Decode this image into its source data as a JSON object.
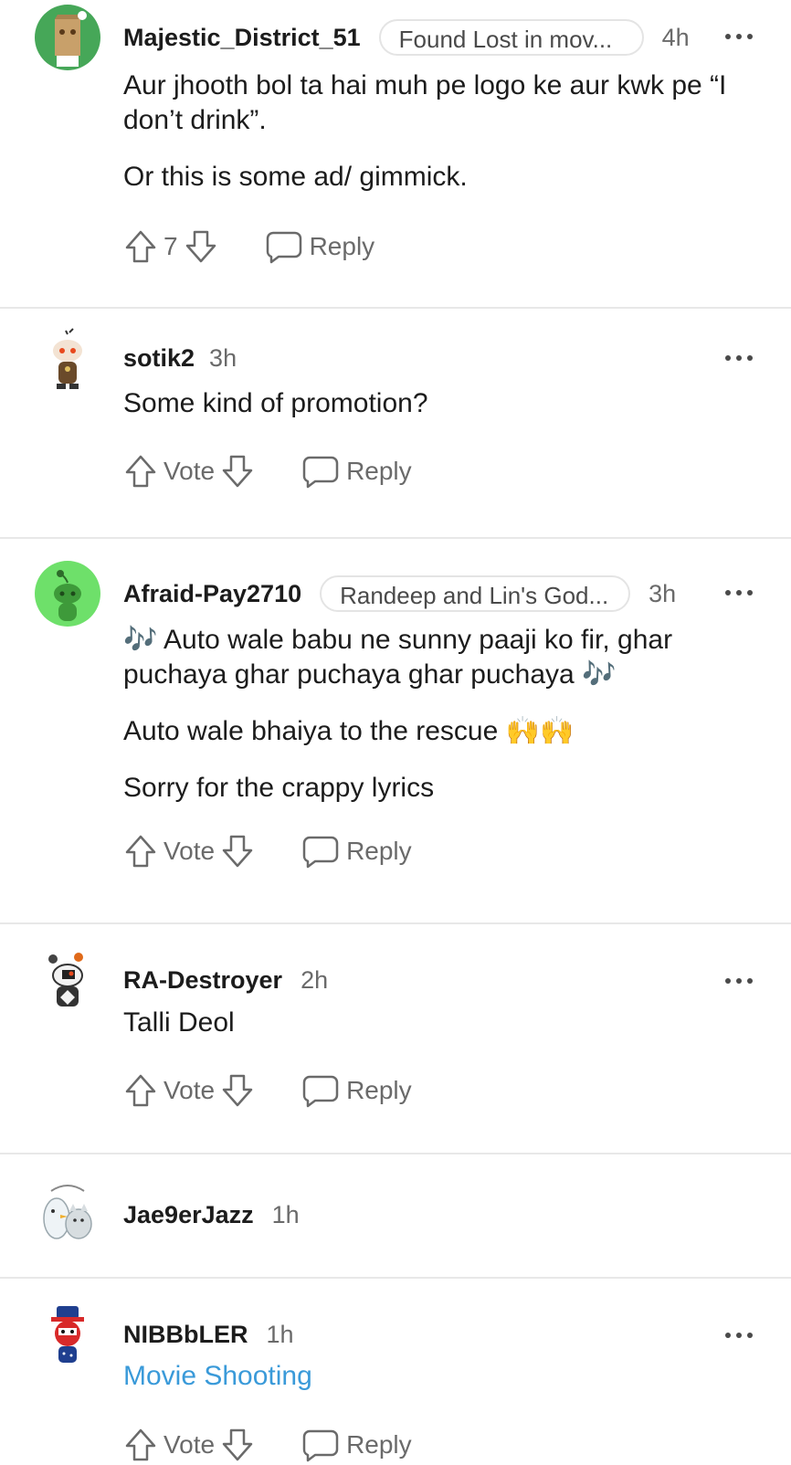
{
  "comments": [
    {
      "username": "Majestic_District_51",
      "flair": "Found Lost in mov...",
      "time": "4h",
      "paragraphs": [
        "Aur jhooth bol ta hai muh pe logo ke aur kwk pe “I don’t drink”.",
        "Or this is some ad/ gimmick."
      ],
      "vote_label": "7",
      "reply_label": "Reply",
      "avatar_color": "#46a758"
    },
    {
      "username": "sotik2",
      "time": "3h",
      "paragraphs": [
        "Some kind of promotion?"
      ],
      "vote_label": "Vote",
      "reply_label": "Reply"
    },
    {
      "username": "Afraid-Pay2710",
      "flair": "Randeep and Lin's God...",
      "time": "3h",
      "paragraphs": [
        "Auto wale babu ne sunny paaji ko fir, ghar puchaya ghar puchaya ghar puchaya",
        "Auto wale bhaiya to the rescue",
        "Sorry for the crappy lyrics"
      ],
      "note_glyph": "🎶",
      "hands_glyph": "🙌🙌",
      "vote_label": "Vote",
      "reply_label": "Reply",
      "avatar_color": "#6ee06a"
    },
    {
      "username": "RA-Destroyer",
      "time": "2h",
      "paragraphs": [
        "Talli Deol"
      ],
      "vote_label": "Vote",
      "reply_label": "Reply"
    },
    {
      "username": "Jae9erJazz",
      "time": "1h"
    },
    {
      "username": "NIBBbLER",
      "time": "1h",
      "paragraphs": [
        "Movie Shooting"
      ],
      "vote_label": "Vote",
      "reply_label": "Reply",
      "link_color": "#3a9ad9"
    }
  ]
}
